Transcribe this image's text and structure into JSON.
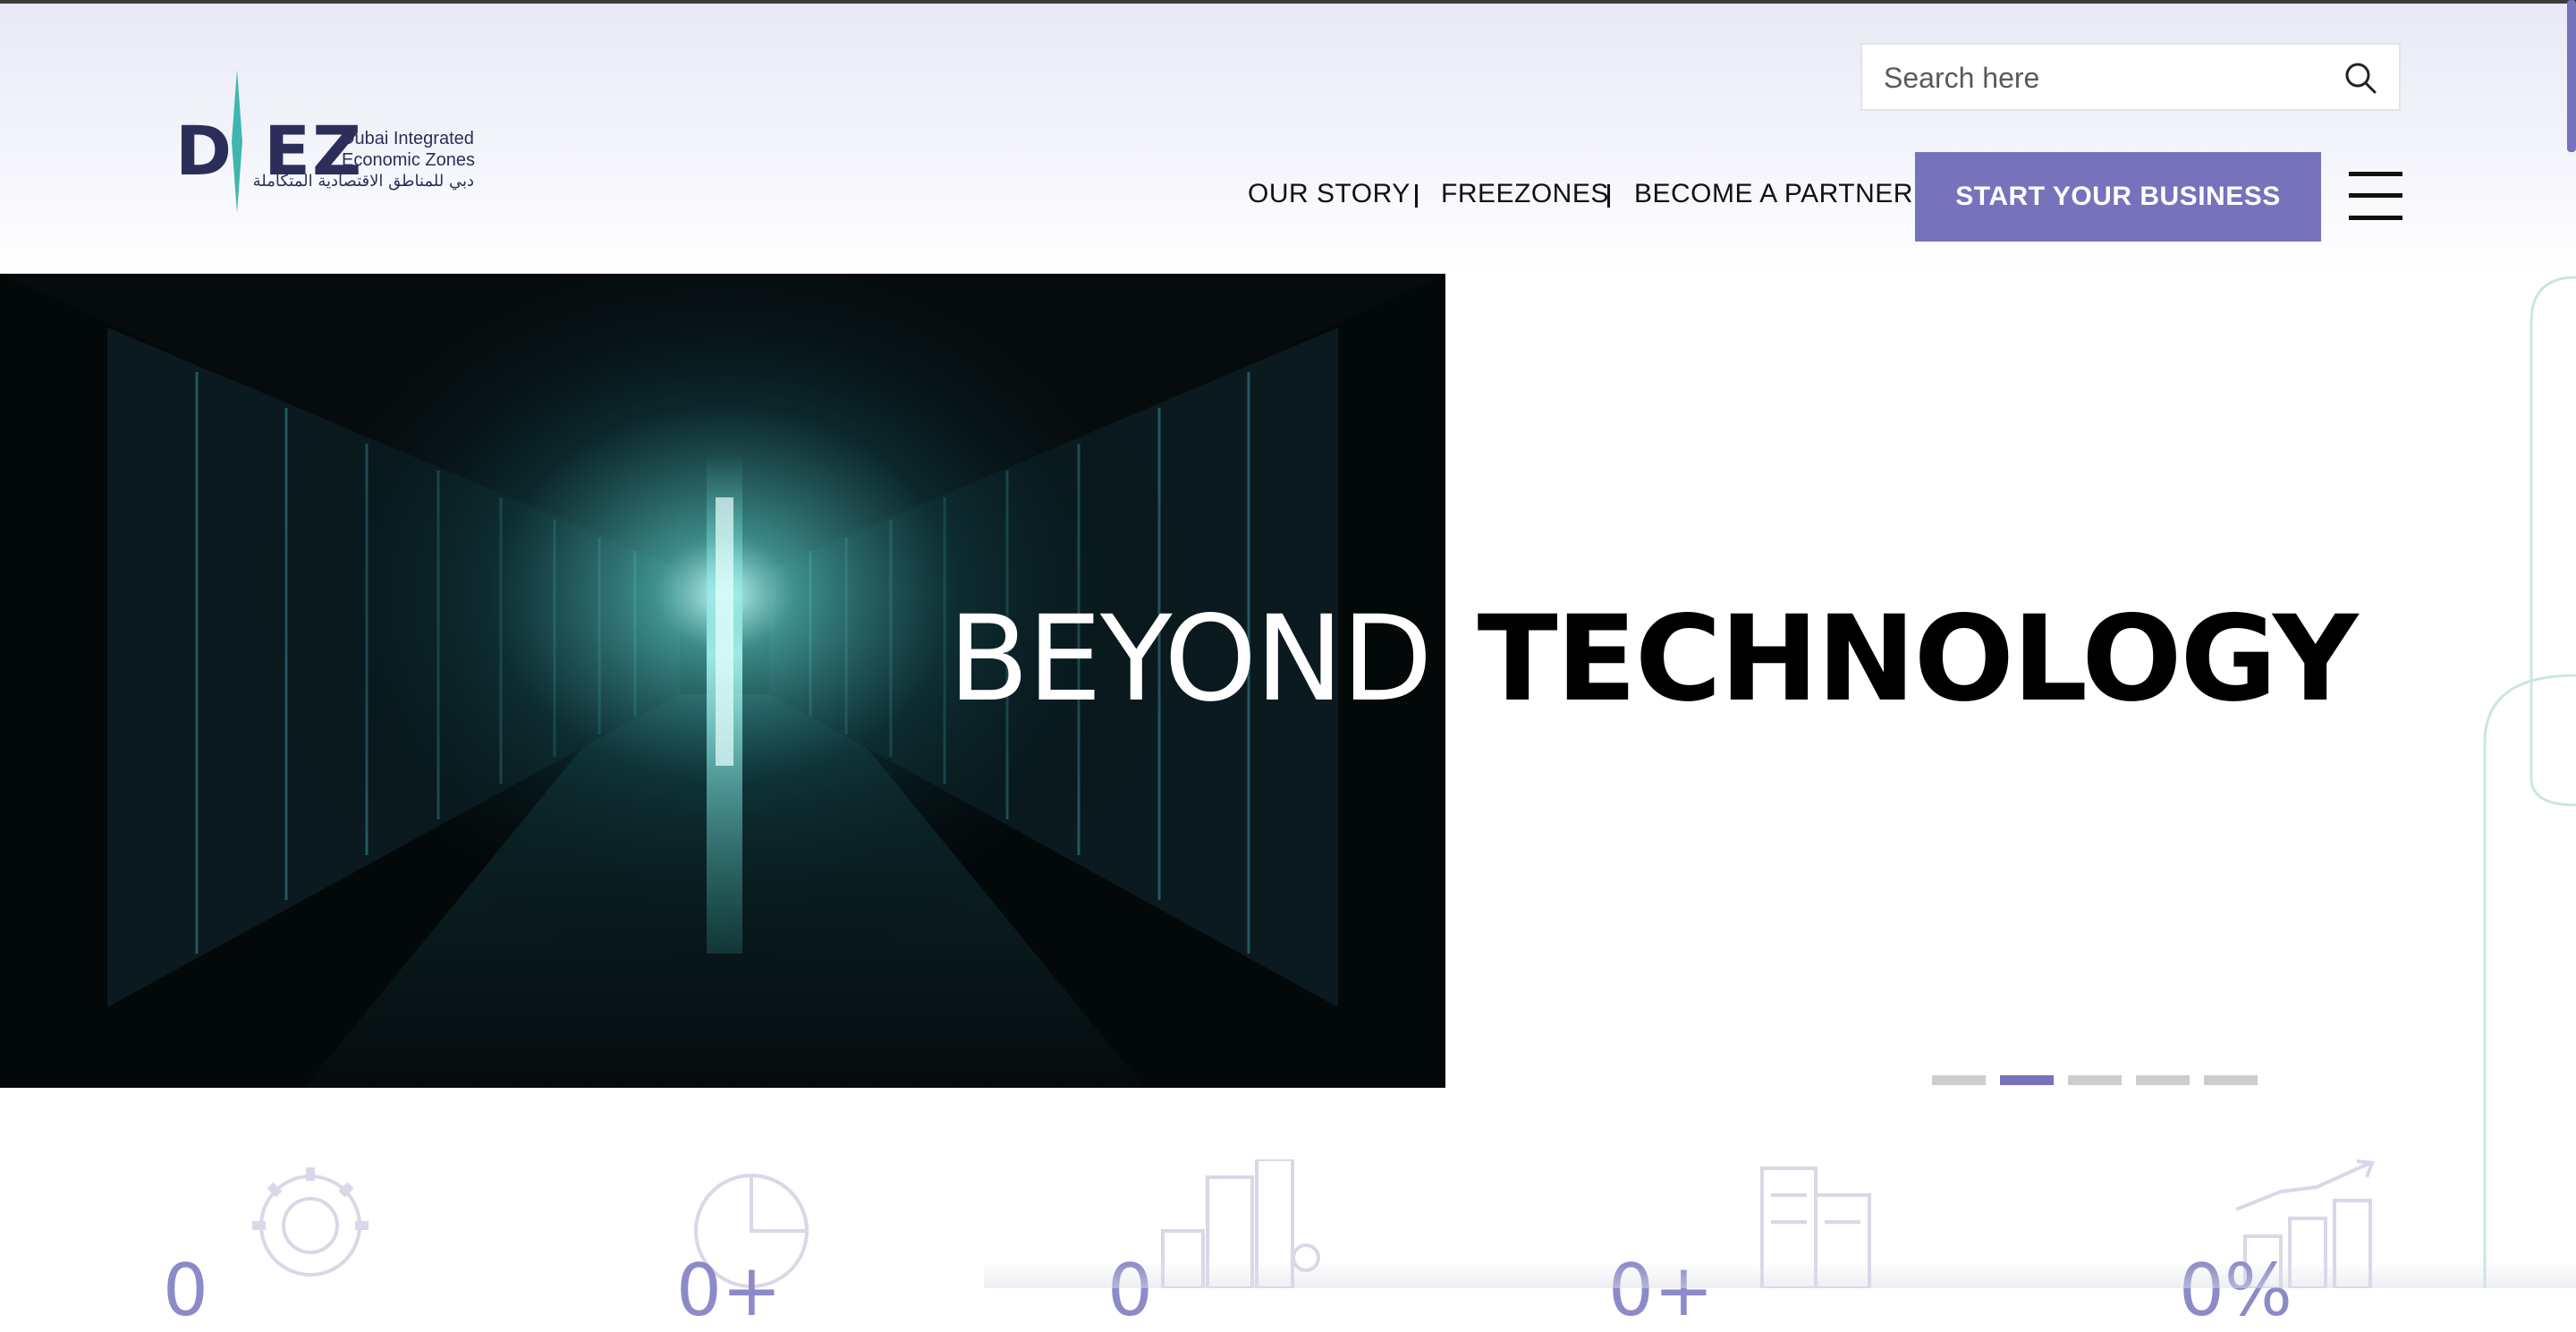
{
  "logo": {
    "mark_left": "D",
    "mark_right": "EZ",
    "line1": "Dubai Integrated",
    "line2": "Economic Zones",
    "line3": "دبي للمناطق الاقتصادية المتكاملة",
    "brand_color": "#2c2e5a",
    "accent_color": "#3fb6b0"
  },
  "search": {
    "placeholder": "Search here",
    "icon": "search-icon"
  },
  "nav": {
    "items": [
      {
        "label": "OUR STORY"
      },
      {
        "label": "FREEZONES"
      },
      {
        "label": "BECOME A PARTNER"
      }
    ],
    "cta_label": "START YOUR BUSINESS",
    "cta_color": "#7672bc",
    "menu_icon": "hamburger-menu-icon"
  },
  "hero": {
    "title_light": "BEYOND",
    "title_bold": "TECHNOLOGY",
    "image": "server-room-corridor",
    "slides_total": 5,
    "active_slide": 2
  },
  "stats": [
    {
      "icon": "gear-people-icon",
      "value": "0"
    },
    {
      "icon": "pie-chart-icon",
      "value": "0+"
    },
    {
      "icon": "city-buildings-icon",
      "value": "0"
    },
    {
      "icon": "office-building-icon",
      "value": "0+"
    },
    {
      "icon": "growth-chart-icon",
      "value": "0%"
    }
  ]
}
